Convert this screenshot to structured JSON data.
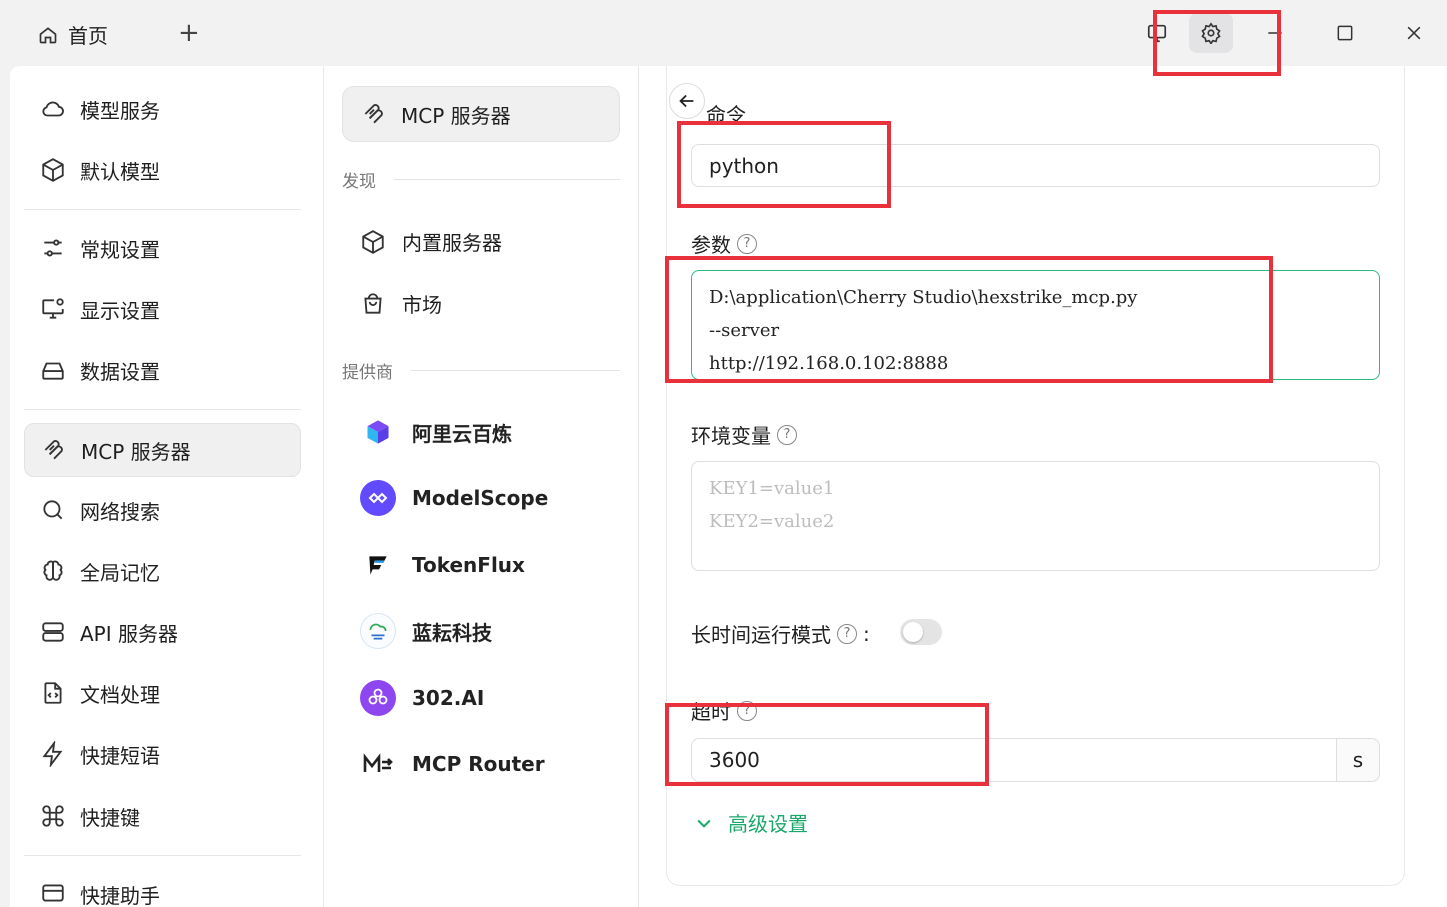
{
  "titlebar": {
    "home_tab": "首页"
  },
  "sidebar": {
    "items": [
      {
        "label": "模型服务",
        "icon": "cloud-icon"
      },
      {
        "label": "默认模型",
        "icon": "cube-icon"
      },
      {
        "label": "常规设置",
        "icon": "sliders-icon"
      },
      {
        "label": "显示设置",
        "icon": "monitor-gear-icon"
      },
      {
        "label": "数据设置",
        "icon": "hard-drive-icon"
      },
      {
        "label": "MCP 服务器",
        "icon": "mcp-icon"
      },
      {
        "label": "网络搜索",
        "icon": "search-icon"
      },
      {
        "label": "全局记忆",
        "icon": "brain-icon"
      },
      {
        "label": "API 服务器",
        "icon": "server-icon"
      },
      {
        "label": "文档处理",
        "icon": "file-code-icon"
      },
      {
        "label": "快捷短语",
        "icon": "zap-icon"
      },
      {
        "label": "快捷键",
        "icon": "command-icon"
      },
      {
        "label": "快捷助手",
        "icon": "assistant-icon"
      }
    ]
  },
  "mcp_nav": {
    "active_label": "MCP 服务器",
    "discover_heading": "发现",
    "discover_items": [
      {
        "label": "内置服务器",
        "icon": "cube-icon"
      },
      {
        "label": "市场",
        "icon": "shopping-bag-icon"
      }
    ],
    "providers_heading": "提供商",
    "providers": [
      {
        "label": "阿里云百炼",
        "logo": "bailian-logo",
        "color": "#6e4cf5"
      },
      {
        "label": "ModelScope",
        "logo": "modelscope-logo",
        "color": "#624aff"
      },
      {
        "label": "TokenFlux",
        "logo": "tokenflux-logo",
        "color": "#1c7cf2"
      },
      {
        "label": "蓝耘科技",
        "logo": "lanyun-logo",
        "color": "#2b6fd1"
      },
      {
        "label": "302.AI",
        "logo": "302ai-logo",
        "color": "#8e47f0"
      },
      {
        "label": "MCP Router",
        "logo": "mcp-router-logo",
        "color": "#222222"
      }
    ]
  },
  "form": {
    "command_label": "命令",
    "command_value": "python",
    "args_label": "参数",
    "args_value": "D:\\application\\Cherry Studio\\hexstrike_mcp.py\n--server\nhttp://192.168.0.102:8888",
    "env_label": "环境变量",
    "env_placeholder": "KEY1=value1\nKEY2=value2",
    "long_running_label": "长时间运行模式",
    "long_running_colon": ":",
    "long_running_on": false,
    "timeout_label": "超时",
    "timeout_value": "3600",
    "timeout_unit": "s",
    "advanced_label": "高级设置"
  },
  "colors": {
    "accent": "#1aa86a",
    "highlight": "#e9313b"
  }
}
